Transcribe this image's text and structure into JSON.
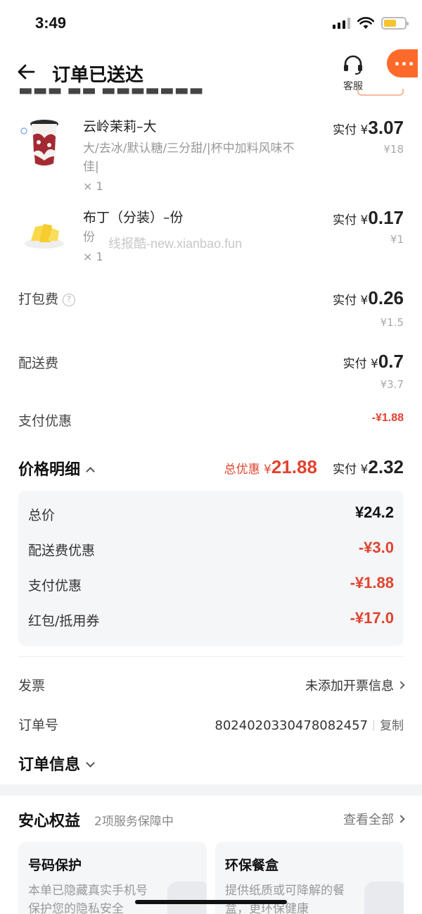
{
  "status_bar": {
    "time": "3:49"
  },
  "nav": {
    "title": "订单已送达",
    "service_label": "客服"
  },
  "items": [
    {
      "name": "云岭茉莉–大",
      "spec": "大/去冰/默认糖/三分甜/|杯中加料风味不佳|",
      "qty": "× 1",
      "pay_prefix": "实付 ¥",
      "pay_amount": "3.07",
      "original": "¥18"
    },
    {
      "name": "布丁（分装）–份",
      "spec": "份",
      "qty": "× 1",
      "pay_prefix": "实付 ¥",
      "pay_amount": "0.17",
      "original": "¥1"
    }
  ],
  "watermark": "线报酷-new.xianbao.fun",
  "fees": {
    "packing": {
      "label": "打包费",
      "help": "?",
      "pay_prefix": "实付 ¥",
      "pay_amount": "0.26",
      "original": "¥1.5"
    },
    "delivery": {
      "label": "配送费",
      "pay_prefix": "实付 ¥",
      "pay_amount": "0.7",
      "original": "¥3.7"
    },
    "payment_discount": {
      "label": "支付优惠",
      "value": "-¥1.88"
    }
  },
  "price_detail": {
    "title": "价格明细",
    "total_discount_prefix": "总优惠 ¥",
    "total_discount": "21.88",
    "paid_prefix": "实付 ¥",
    "paid": "2.32",
    "lines": [
      {
        "label": "总价",
        "value": "¥24.2"
      },
      {
        "label": "配送费优惠",
        "value": "-¥3.0"
      },
      {
        "label": "支付优惠",
        "value": "-¥1.88"
      },
      {
        "label": "红包/抵用券",
        "value": "-¥17.0"
      }
    ]
  },
  "invoice": {
    "label": "发票",
    "value": "未添加开票信息"
  },
  "order_no": {
    "label": "订单号",
    "value": "8024020330478082457",
    "copy": "复制"
  },
  "order_info": {
    "title": "订单信息"
  },
  "anxin": {
    "title": "安心权益",
    "subtitle": "2项服务保障中",
    "view_all": "查看全部",
    "cards": [
      {
        "title": "号码保护",
        "desc": "本单已隐藏真实手机号保护您的隐私安全"
      },
      {
        "title": "环保餐盒",
        "desc": "提供纸质或可降解的餐盒，更环保健康"
      }
    ]
  },
  "colors": {
    "accent_red": "#e0442f",
    "brand_orange": "#ff6a2a"
  }
}
